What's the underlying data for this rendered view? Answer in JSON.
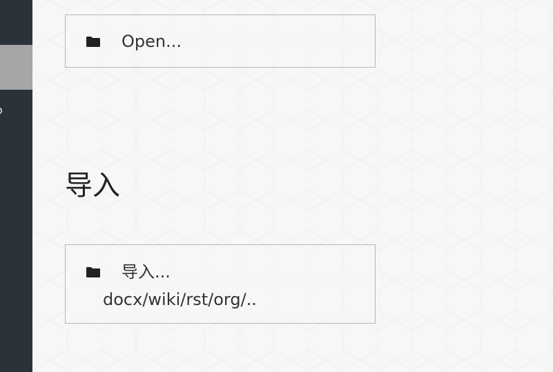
{
  "sidebar": {
    "edge_glyph": "o"
  },
  "open_action": {
    "icon": "folder-icon",
    "label": "Open..."
  },
  "import_section": {
    "title": "导入",
    "action": {
      "icon": "folder-icon",
      "label": "导入...",
      "formats": "docx/wiki/rst/org/.."
    }
  },
  "colors": {
    "sidebar": "#2c323a",
    "sidebar_active": "#a4a6a8",
    "background": "#f7f7f7",
    "box_border": "#b5b5b5",
    "text": "#333333"
  }
}
